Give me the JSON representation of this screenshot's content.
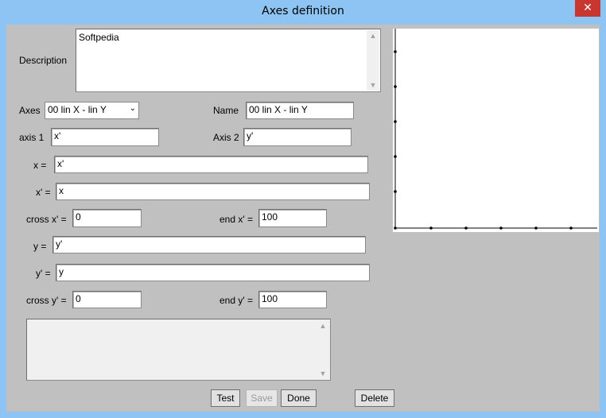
{
  "window": {
    "title": "Axes definition",
    "close_glyph": "✕"
  },
  "description": {
    "label": "Description",
    "value": "Softpedia"
  },
  "axes": {
    "label": "Axes",
    "selected": "00 lin X - lin Y"
  },
  "name": {
    "label": "Name",
    "value": "00 lin X - lin Y"
  },
  "axis1": {
    "label": "axis 1",
    "value": "x'"
  },
  "axis2": {
    "label": "Axis 2",
    "value": "y'"
  },
  "x_eq": {
    "label": "x =",
    "value": "x'"
  },
  "xprime_eq": {
    "label": "x' =",
    "value": "x"
  },
  "cross_x": {
    "label": "cross x' =",
    "value": "0"
  },
  "end_x": {
    "label": "end x' =",
    "value": "100"
  },
  "y_eq": {
    "label": "y =",
    "value": "y'"
  },
  "yprime_eq": {
    "label": "y' =",
    "value": "y"
  },
  "cross_y": {
    "label": "cross y' =",
    "value": "0"
  },
  "end_y": {
    "label": "end y' =",
    "value": "100"
  },
  "notes": {
    "value": ""
  },
  "buttons": {
    "test": "Test",
    "save": "Save",
    "done": "Done",
    "delete": "Delete"
  },
  "colors": {
    "titlebar": "#8ec4f4",
    "client": "#c0c0c0",
    "close": "#c7372f"
  },
  "icons": {
    "scroll_up": "chevron-up-icon",
    "scroll_down": "chevron-down-icon",
    "dropdown": "chevron-down-icon"
  }
}
